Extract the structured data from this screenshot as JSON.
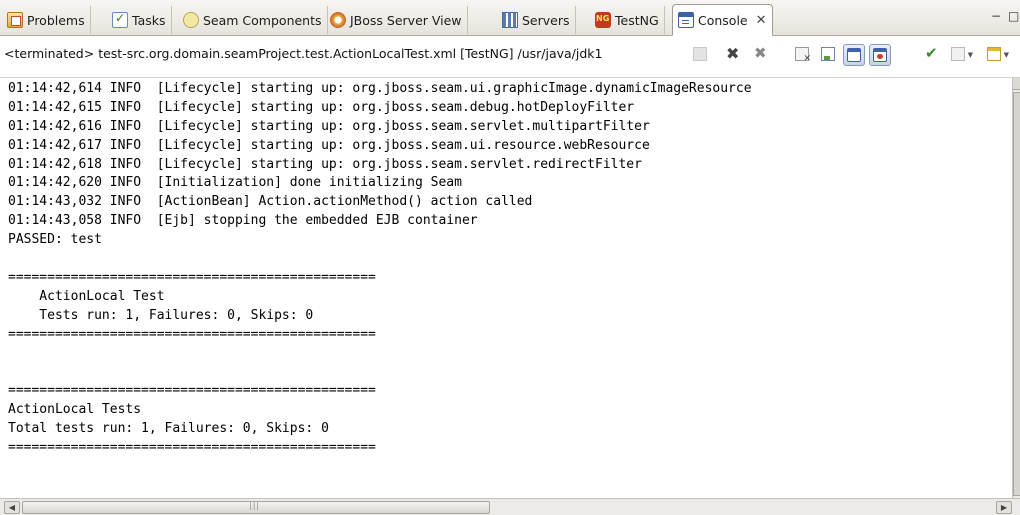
{
  "tabs": [
    {
      "label": "Problems",
      "icon": "problems-icon"
    },
    {
      "label": "Tasks",
      "icon": "tasks-icon"
    },
    {
      "label": "Seam Components",
      "icon": "seam-components-icon"
    },
    {
      "label": "JBoss Server View",
      "icon": "jboss-server-icon"
    },
    {
      "label": "Servers",
      "icon": "servers-icon"
    },
    {
      "label": "TestNG",
      "icon": "testng-icon"
    },
    {
      "label": "Console",
      "icon": "console-icon",
      "active": true,
      "close": "✕"
    }
  ],
  "window_controls": {
    "minimize": "−",
    "maximize": "□"
  },
  "status": {
    "text": "<terminated> test-src.org.domain.seamProject.test.ActionLocalTest.xml [TestNG] /usr/java/jdk1"
  },
  "toolbar": [
    "terminate-icon",
    "remove-launch-icon",
    "remove-all-terminated-icon",
    "clear-console-icon",
    "scroll-lock-icon",
    "show-on-stdout-icon",
    "show-on-stderr-icon",
    "pin-console-icon",
    "display-selected-console-icon",
    "open-console-icon"
  ],
  "console": {
    "lines": [
      "01:14:42,614 INFO  [Lifecycle] starting up: org.jboss.seam.ui.graphicImage.dynamicImageResource",
      "01:14:42,615 INFO  [Lifecycle] starting up: org.jboss.seam.debug.hotDeployFilter",
      "01:14:42,616 INFO  [Lifecycle] starting up: org.jboss.seam.servlet.multipartFilter",
      "01:14:42,617 INFO  [Lifecycle] starting up: org.jboss.seam.ui.resource.webResource",
      "01:14:42,618 INFO  [Lifecycle] starting up: org.jboss.seam.servlet.redirectFilter",
      "01:14:42,620 INFO  [Initialization] done initializing Seam",
      "01:14:43,032 INFO  [ActionBean] Action.actionMethod() action called",
      "01:14:43,058 INFO  [Ejb] stopping the embedded EJB container",
      "PASSED: test",
      "",
      "===============================================",
      "    ActionLocal Test",
      "    Tests run: 1, Failures: 0, Skips: 0",
      "===============================================",
      "",
      "",
      "===============================================",
      "ActionLocal Tests",
      "Total tests run: 1, Failures: 0, Skips: 0",
      "==============================================="
    ]
  },
  "colors": {
    "tabbar_bg": "#e6e3dc",
    "console_bg": "#ffffff",
    "console_text": "#000000",
    "active_icon": "#3d62a8"
  }
}
